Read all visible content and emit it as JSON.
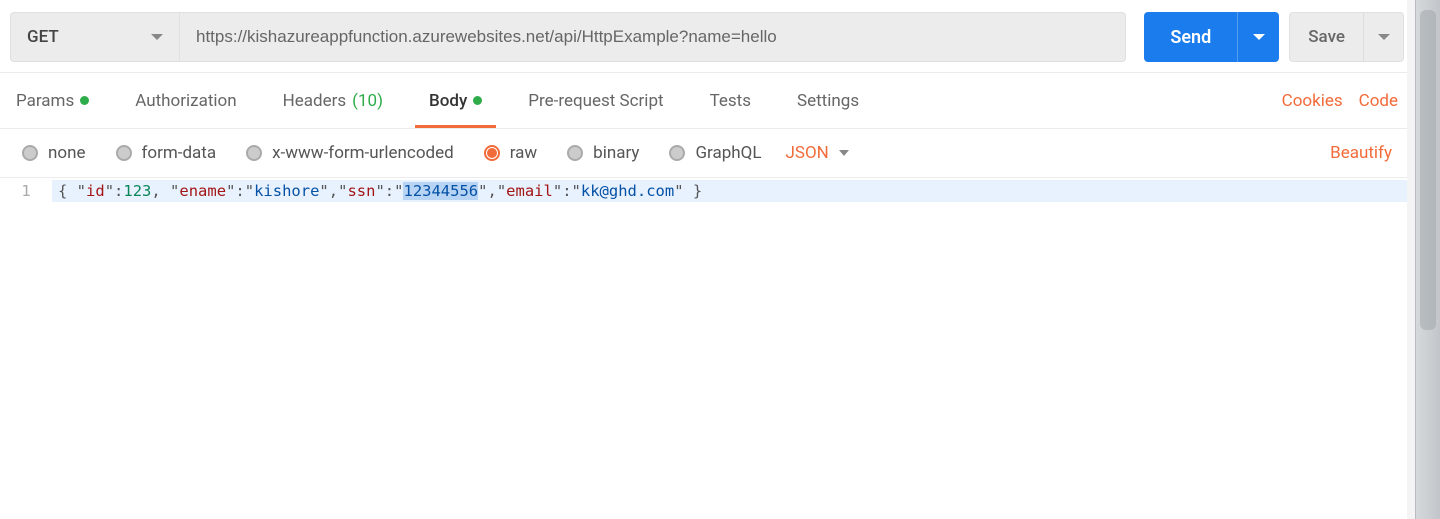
{
  "request": {
    "method": "GET",
    "url": "https://kishazureappfunction.azurewebsites.net/api/HttpExample?name=hello",
    "send_label": "Send",
    "save_label": "Save"
  },
  "tabs": {
    "items": [
      {
        "label": "Params",
        "has_dot": true,
        "active": false
      },
      {
        "label": "Authorization",
        "has_dot": false,
        "active": false
      },
      {
        "label": "Headers",
        "count": "(10)",
        "has_dot": false,
        "active": false
      },
      {
        "label": "Body",
        "has_dot": true,
        "active": true
      },
      {
        "label": "Pre-request Script",
        "has_dot": false,
        "active": false
      },
      {
        "label": "Tests",
        "has_dot": false,
        "active": false
      },
      {
        "label": "Settings",
        "has_dot": false,
        "active": false
      }
    ],
    "cookies_label": "Cookies",
    "code_label": "Code"
  },
  "body_types": {
    "items": [
      {
        "label": "none",
        "selected": false
      },
      {
        "label": "form-data",
        "selected": false
      },
      {
        "label": "x-www-form-urlencoded",
        "selected": false
      },
      {
        "label": "raw",
        "selected": true
      },
      {
        "label": "binary",
        "selected": false
      },
      {
        "label": "GraphQL",
        "selected": false
      }
    ],
    "format": "JSON",
    "beautify_label": "Beautify"
  },
  "editor": {
    "line_number": "1",
    "body_json": {
      "id": 123,
      "ename": "kishore",
      "ssn": "12344556",
      "email": "kk@ghd.com"
    },
    "tokens": {
      "open": "{ ",
      "q": "\"",
      "colon": ":",
      "comma": ",",
      "comma_sp": ", ",
      "close": " }",
      "k_id": "id",
      "v_id": "123",
      "k_ename": "ename",
      "v_ename": "kishore",
      "k_ssn": "ssn",
      "v_ssn": "12344556",
      "k_email": "email",
      "v_email": "kk@ghd.com"
    }
  }
}
